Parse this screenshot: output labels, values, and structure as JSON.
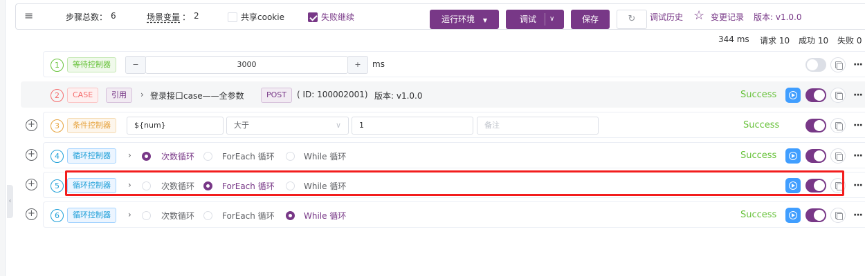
{
  "toolbar": {
    "step_total_label": "步骤总数：",
    "step_total_value": "6",
    "scene_var_label": "场景变量",
    "scene_var_sep": "：",
    "scene_var_value": "2",
    "share_cookie": {
      "label": "共享cookie",
      "checked": false
    },
    "fail_continue": {
      "label": "失败继续",
      "checked": true
    },
    "env_button": "运行环境",
    "debug_button": "调试",
    "save_button": "保存",
    "debug_history": "调试历史",
    "change_log": "变更记录",
    "version": "版本: v1.0.0"
  },
  "stats": {
    "duration": "344 ms",
    "requests": "请求 10",
    "success": "成功 10",
    "fail": "失败 0"
  },
  "steps": [
    {
      "index": "1",
      "type_label": "等待控制器",
      "minus": "−",
      "value": "3000",
      "plus": "+",
      "unit": "ms",
      "enabled": false
    },
    {
      "index": "2",
      "case_tag": "CASE",
      "ref_tag": "引用",
      "name": "登录接口case——全参数",
      "method": "POST",
      "id_text": "( ID: 100002001)",
      "version": "版本: v1.0.0",
      "status": "Success",
      "enabled": true
    },
    {
      "index": "3",
      "type_label": "条件控制器",
      "variable": "${num}",
      "operator": "大于",
      "compare_value": "1",
      "note_placeholder": "备注",
      "status": "Success",
      "enabled": true
    },
    {
      "index": "4",
      "type_label": "循环控制器",
      "loop_options": [
        "次数循环",
        "ForEach 循环",
        "While 循环"
      ],
      "selected": "次数循环",
      "status": "Success",
      "enabled": true
    },
    {
      "index": "5",
      "type_label": "循环控制器",
      "loop_options": [
        "次数循环",
        "ForEach 循环",
        "While 循环"
      ],
      "selected": "ForEach 循环",
      "enabled": true
    },
    {
      "index": "6",
      "type_label": "循环控制器",
      "loop_options": [
        "次数循环",
        "ForEach 循环",
        "While 循环"
      ],
      "selected": "While 循环",
      "status": "Success",
      "enabled": true
    }
  ],
  "colors": {
    "accent": "#783887",
    "success": "#67c23a",
    "highlight": "#f21d1d",
    "wait_green": "#67c23a",
    "case_red": "#f56c6c",
    "cond_orange": "#e6a23c",
    "loop_blue": "#1e9fd8"
  }
}
